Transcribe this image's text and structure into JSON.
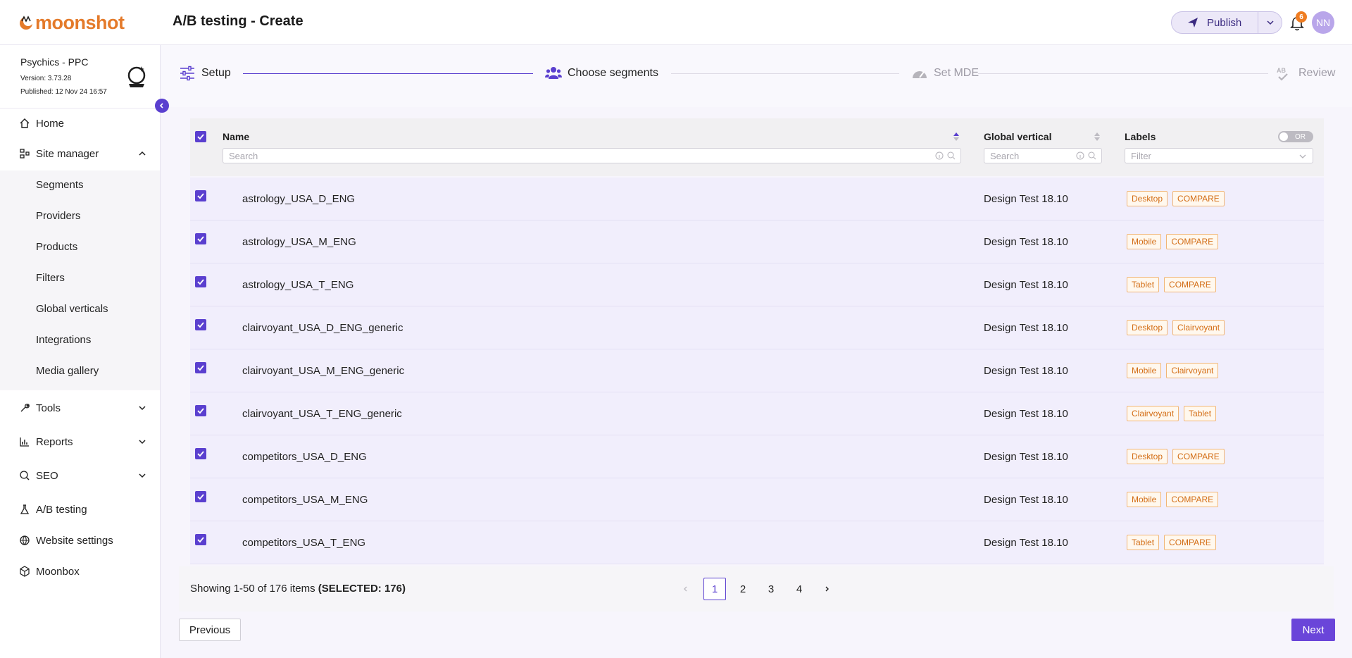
{
  "header": {
    "logo_text": "moonshot",
    "page_title": "A/B testing - Create",
    "publish_label": "Publish",
    "notification_count": "6",
    "avatar_initials": "NN"
  },
  "site": {
    "name": "Psychics - PPC",
    "version": "Version: 3.73.28",
    "published": "Published: 12 Nov 24 16:57"
  },
  "sidebar": {
    "home": "Home",
    "site_manager": "Site manager",
    "sub_items": [
      "Segments",
      "Providers",
      "Products",
      "Filters",
      "Global verticals",
      "Integrations",
      "Media gallery"
    ],
    "tools": "Tools",
    "reports": "Reports",
    "seo": "SEO",
    "ab_testing": "A/B testing",
    "website_settings": "Website settings",
    "moonbox": "Moonbox"
  },
  "stepper": {
    "steps": [
      "Setup",
      "Choose segments",
      "Set MDE",
      "Review"
    ],
    "active_step": 1
  },
  "table": {
    "columns": {
      "name": "Name",
      "vertical": "Global vertical",
      "labels": "Labels"
    },
    "name_search_placeholder": "Search",
    "vertical_search_placeholder": "Search",
    "labels_filter_placeholder": "Filter",
    "toggle_label": "OR",
    "rows": [
      {
        "name": "astrology_USA_D_ENG",
        "vertical": "Design Test 18.10",
        "labels": [
          "Desktop",
          "COMPARE"
        ]
      },
      {
        "name": "astrology_USA_M_ENG",
        "vertical": "Design Test 18.10",
        "labels": [
          "Mobile",
          "COMPARE"
        ]
      },
      {
        "name": "astrology_USA_T_ENG",
        "vertical": "Design Test 18.10",
        "labels": [
          "Tablet",
          "COMPARE"
        ]
      },
      {
        "name": "clairvoyant_USA_D_ENG_generic",
        "vertical": "Design Test 18.10",
        "labels": [
          "Desktop",
          "Clairvoyant"
        ]
      },
      {
        "name": "clairvoyant_USA_M_ENG_generic",
        "vertical": "Design Test 18.10",
        "labels": [
          "Mobile",
          "Clairvoyant"
        ]
      },
      {
        "name": "clairvoyant_USA_T_ENG_generic",
        "vertical": "Design Test 18.10",
        "labels": [
          "Clairvoyant",
          "Tablet"
        ]
      },
      {
        "name": "competitors_USA_D_ENG",
        "vertical": "Design Test 18.10",
        "labels": [
          "Desktop",
          "COMPARE"
        ]
      },
      {
        "name": "competitors_USA_M_ENG",
        "vertical": "Design Test 18.10",
        "labels": [
          "Mobile",
          "COMPARE"
        ]
      },
      {
        "name": "competitors_USA_T_ENG",
        "vertical": "Design Test 18.10",
        "labels": [
          "Tablet",
          "COMPARE"
        ]
      }
    ]
  },
  "footer": {
    "showing_text": "Showing 1-50 of 176 items",
    "selected_text": "(SELECTED: 176)",
    "pages": [
      "1",
      "2",
      "3",
      "4"
    ],
    "current_page": "1",
    "previous_label": "Previous",
    "next_label": "Next"
  },
  "colors": {
    "accent": "#5a3fcf",
    "brand_orange": "#e47a2a",
    "tag_text": "#d36d15",
    "row_bg": "#f1eefc"
  }
}
